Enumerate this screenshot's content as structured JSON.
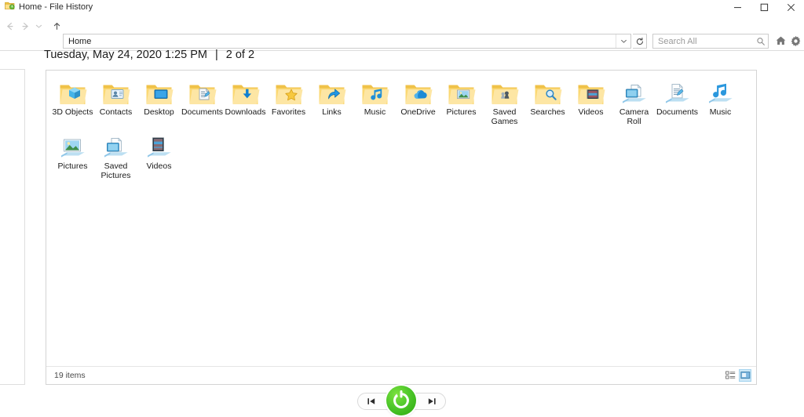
{
  "window": {
    "title": "Home - File History",
    "app_icon": "file-history-icon",
    "controls": {
      "minimize": "minimize-icon",
      "maximize": "maximize-icon",
      "close": "close-icon"
    }
  },
  "toolbar": {
    "back": "back-arrow-icon",
    "forward": "forward-arrow-icon",
    "recent": "chevron-down-icon",
    "up": "up-arrow-icon",
    "address_value": "Home",
    "address_dropdown": "chevron-down-icon",
    "refresh": "refresh-icon",
    "search_placeholder": "Search All",
    "search_icon": "search-icon",
    "home_icon": "home-icon",
    "settings_icon": "gear-icon"
  },
  "header": {
    "date": "Tuesday, May 24, 2020 1:25 PM",
    "separator": "|",
    "count": "2 of 2"
  },
  "content": {
    "items": [
      {
        "label": "3D Objects",
        "icon": "folder-3d-objects-icon"
      },
      {
        "label": "Contacts",
        "icon": "folder-contacts-icon"
      },
      {
        "label": "Desktop",
        "icon": "folder-desktop-icon"
      },
      {
        "label": "Documents",
        "icon": "folder-documents-icon"
      },
      {
        "label": "Downloads",
        "icon": "folder-downloads-icon"
      },
      {
        "label": "Favorites",
        "icon": "folder-favorites-icon"
      },
      {
        "label": "Links",
        "icon": "folder-links-icon"
      },
      {
        "label": "Music",
        "icon": "folder-music-icon"
      },
      {
        "label": "OneDrive",
        "icon": "folder-onedrive-icon"
      },
      {
        "label": "Pictures",
        "icon": "folder-pictures-icon"
      },
      {
        "label": "Saved Games",
        "icon": "folder-saved-games-icon"
      },
      {
        "label": "Searches",
        "icon": "folder-searches-icon"
      },
      {
        "label": "Videos",
        "icon": "folder-videos-icon"
      },
      {
        "label": "Camera Roll",
        "icon": "library-camera-roll-icon"
      },
      {
        "label": "Documents",
        "icon": "library-documents-icon"
      },
      {
        "label": "Music",
        "icon": "library-music-icon"
      },
      {
        "label": "Pictures",
        "icon": "library-pictures-icon"
      },
      {
        "label": "Saved Pictures",
        "icon": "library-saved-pictures-icon"
      },
      {
        "label": "Videos",
        "icon": "library-videos-icon"
      }
    ],
    "status": "19 items",
    "view_details_icon": "details-view-icon",
    "view_large_icons_icon": "large-icons-view-icon"
  },
  "playback": {
    "previous": "previous-version-icon",
    "restore": "restore-icon",
    "next": "next-version-icon"
  },
  "colors": {
    "restore_green": "#4ec72a",
    "folder_yellow": "#fbd96b",
    "accent_blue": "#0a84d8",
    "window_bg": "#ffffff"
  }
}
